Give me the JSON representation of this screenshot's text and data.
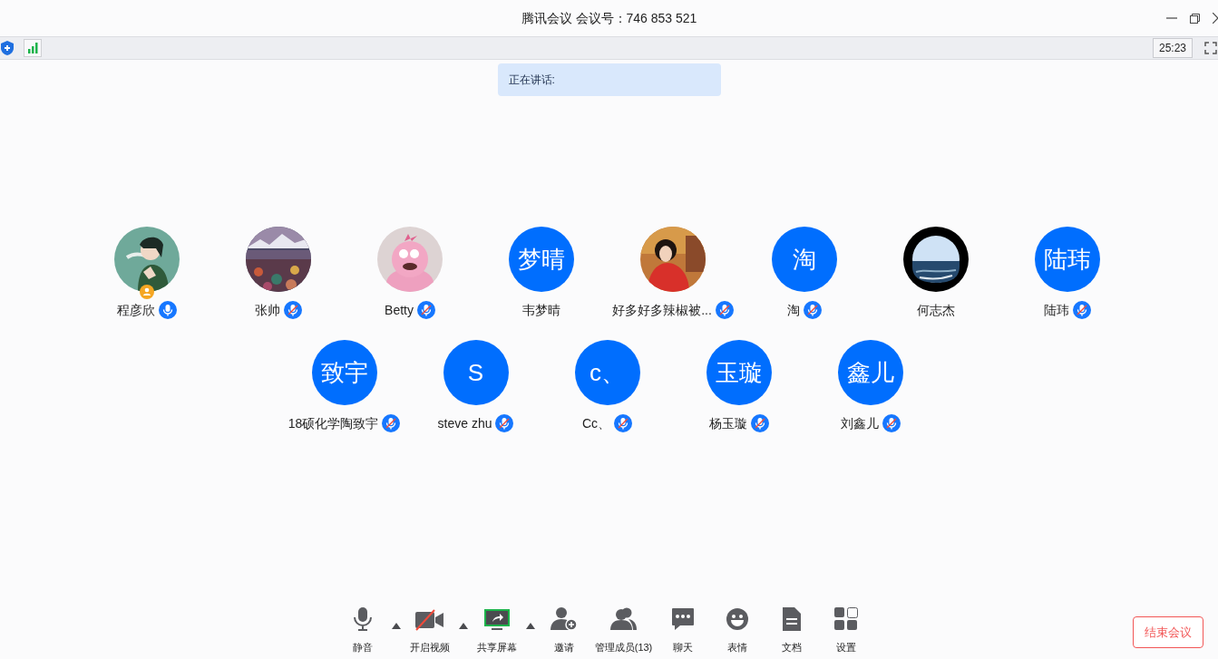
{
  "window": {
    "title": "腾讯会议 会议号：746 853 521"
  },
  "status_bar": {
    "timer": "25:23"
  },
  "speaking": {
    "label": "正在讲话:"
  },
  "participants": [
    {
      "name": "程彦欣",
      "host": true,
      "mic": {
        "muted": false
      }
    },
    {
      "name": "张帅",
      "host": false,
      "mic": {
        "muted": true
      }
    },
    {
      "name": "Betty",
      "host": false,
      "mic": {
        "muted": true
      }
    },
    {
      "name": "韦梦晴",
      "avatar": {
        "kind": "initials",
        "text": "梦晴"
      },
      "host": false
    },
    {
      "name": "好多好多辣椒被...",
      "host": false,
      "mic": {
        "muted": true
      }
    },
    {
      "name": "淘",
      "avatar": {
        "kind": "initials",
        "text": "淘"
      },
      "host": false,
      "mic": {
        "muted": true
      }
    },
    {
      "name": "何志杰",
      "host": false
    },
    {
      "name": "陆玮",
      "avatar": {
        "kind": "initials",
        "text": "陆玮"
      },
      "host": false,
      "mic": {
        "muted": true
      }
    },
    {
      "name": "18硕化学陶致宇",
      "avatar": {
        "kind": "initials",
        "text": "致宇"
      },
      "host": false,
      "mic": {
        "muted": true
      }
    },
    {
      "name": "steve zhu",
      "avatar": {
        "kind": "initials",
        "text": "S"
      },
      "host": false,
      "mic": {
        "muted": true
      }
    },
    {
      "name": "Cc、",
      "avatar": {
        "kind": "initials",
        "text": "c、"
      },
      "host": false,
      "mic": {
        "muted": true
      }
    },
    {
      "name": "杨玉璇",
      "avatar": {
        "kind": "initials",
        "text": "玉璇"
      },
      "host": false,
      "mic": {
        "muted": true
      }
    },
    {
      "name": "刘鑫儿",
      "avatar": {
        "kind": "initials",
        "text": "鑫儿"
      },
      "host": false,
      "mic": {
        "muted": true
      }
    }
  ],
  "toolbar": [
    {
      "kind": "button",
      "label": "静音"
    },
    {
      "kind": "caret"
    },
    {
      "kind": "button",
      "label": "开启视频"
    },
    {
      "kind": "caret"
    },
    {
      "kind": "button",
      "label": "共享屏幕"
    },
    {
      "kind": "caret"
    },
    {
      "kind": "button",
      "label": "邀请"
    },
    {
      "kind": "button",
      "label": "管理成员(13)"
    },
    {
      "kind": "button",
      "label": "聊天"
    },
    {
      "kind": "button",
      "label": "表情"
    },
    {
      "kind": "button",
      "label": "文档"
    },
    {
      "kind": "button",
      "label": "设置"
    }
  ],
  "end_button": {
    "label": "结束会议"
  }
}
